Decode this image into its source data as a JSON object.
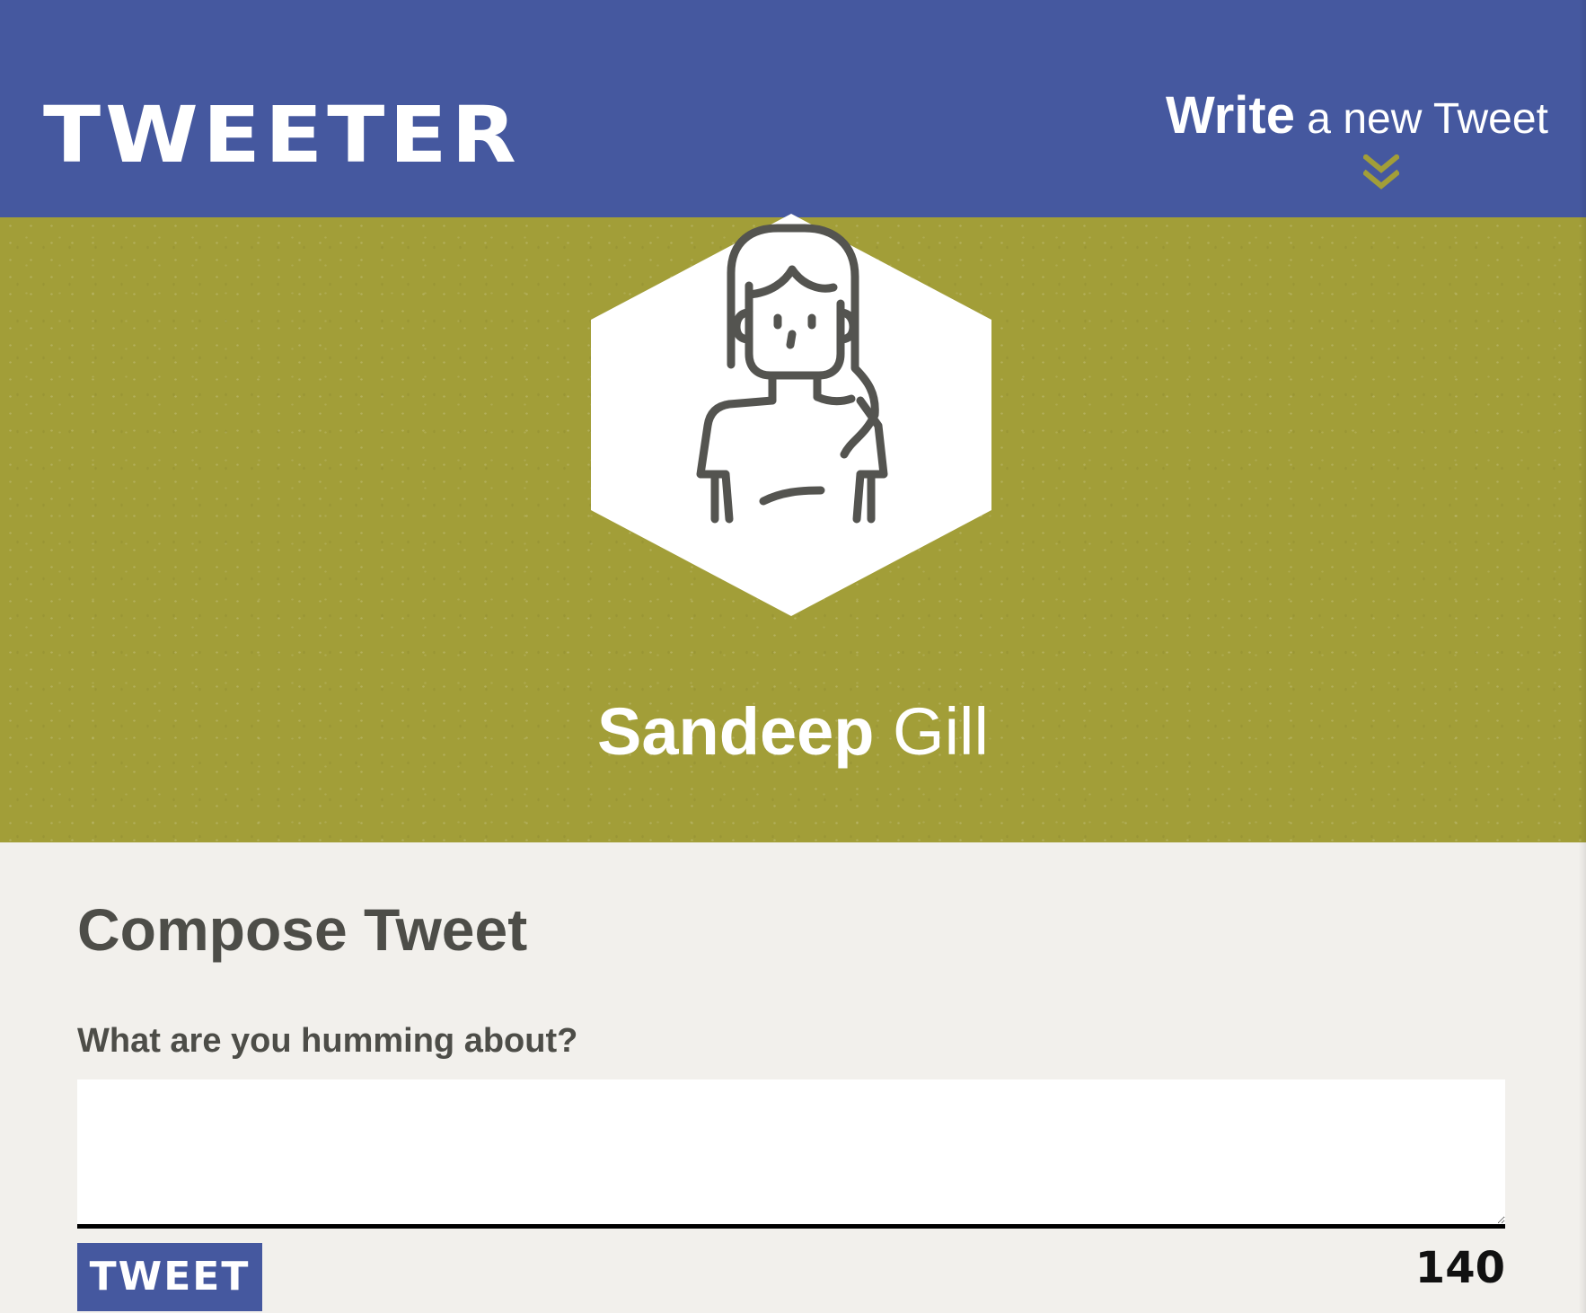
{
  "nav": {
    "brand": "TWEETER",
    "compose_toggle": {
      "strong": "Write",
      "light": " a new Tweet",
      "icon": "double-chevron-down-icon"
    }
  },
  "profile": {
    "first_name": "Sandeep",
    "last_name": " Gill",
    "avatar_icon": "user-avatar-icon"
  },
  "compose": {
    "title": "Compose Tweet",
    "label": "What are you humming about?",
    "textarea_value": "",
    "button_label": "TWEET",
    "counter": "140"
  },
  "colors": {
    "nav_background": "#45589f",
    "banner_background": "#a29e38",
    "compose_background": "#f2f0ec",
    "accent_chevron": "#a29e38",
    "heading_text": "#4d4d48"
  }
}
